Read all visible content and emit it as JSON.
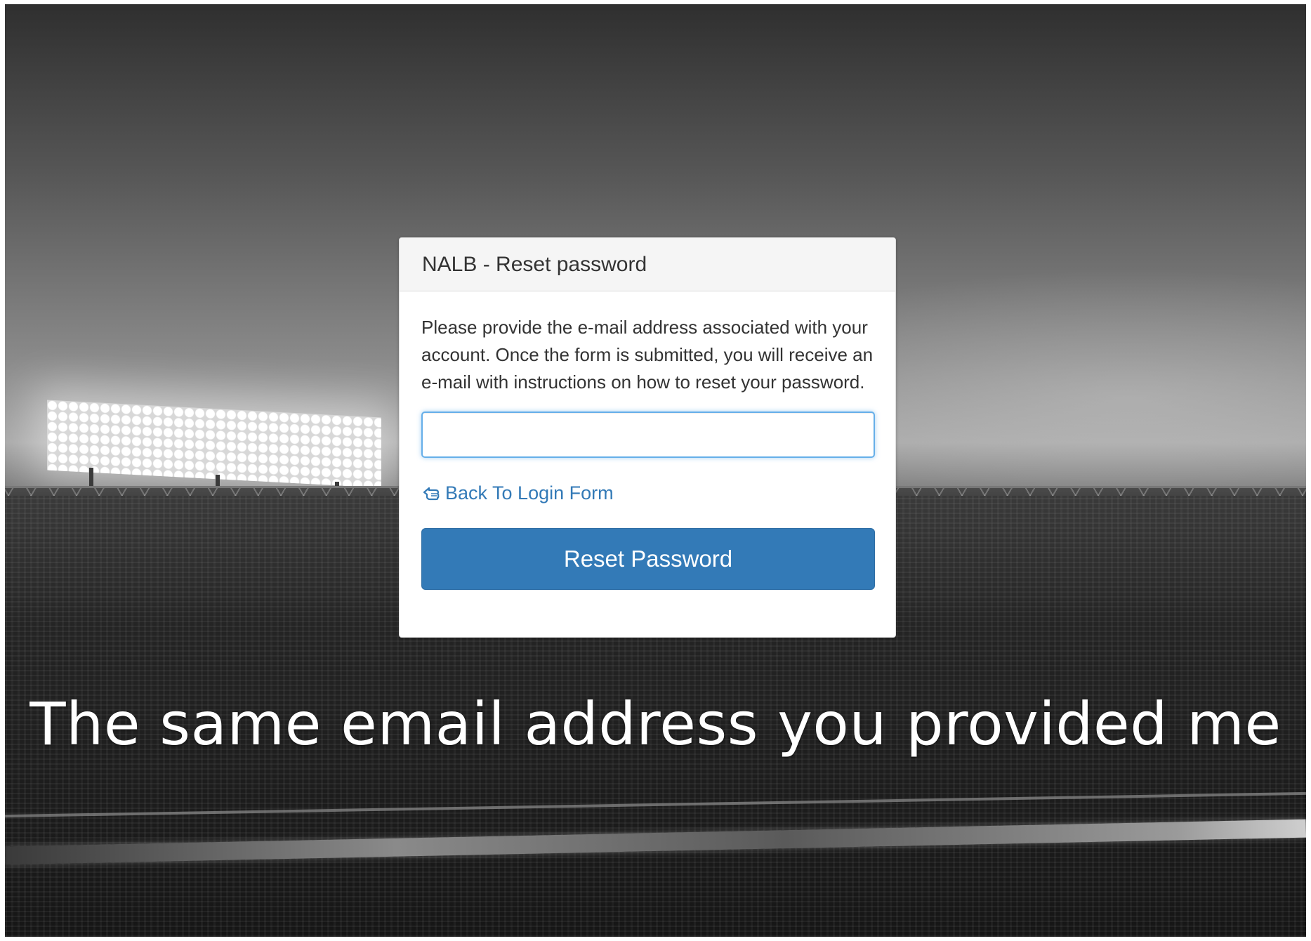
{
  "panel": {
    "title": "NALB - Reset password",
    "description": "Please provide the e-mail address associated with your account. Once the form is submitted, you will receive an e-mail with instructions on how to reset your password.",
    "email_input": {
      "value": "",
      "placeholder": ""
    },
    "back_link": {
      "label": "Back To Login Form",
      "icon": "hand-pointing-left-icon"
    },
    "submit_label": "Reset Password"
  },
  "caption": "The same email address you provided me",
  "colors": {
    "primary": "#337ab7",
    "link": "#337ab7",
    "input_focus_border": "#66afe9",
    "panel_heading_bg": "#f5f5f5"
  }
}
